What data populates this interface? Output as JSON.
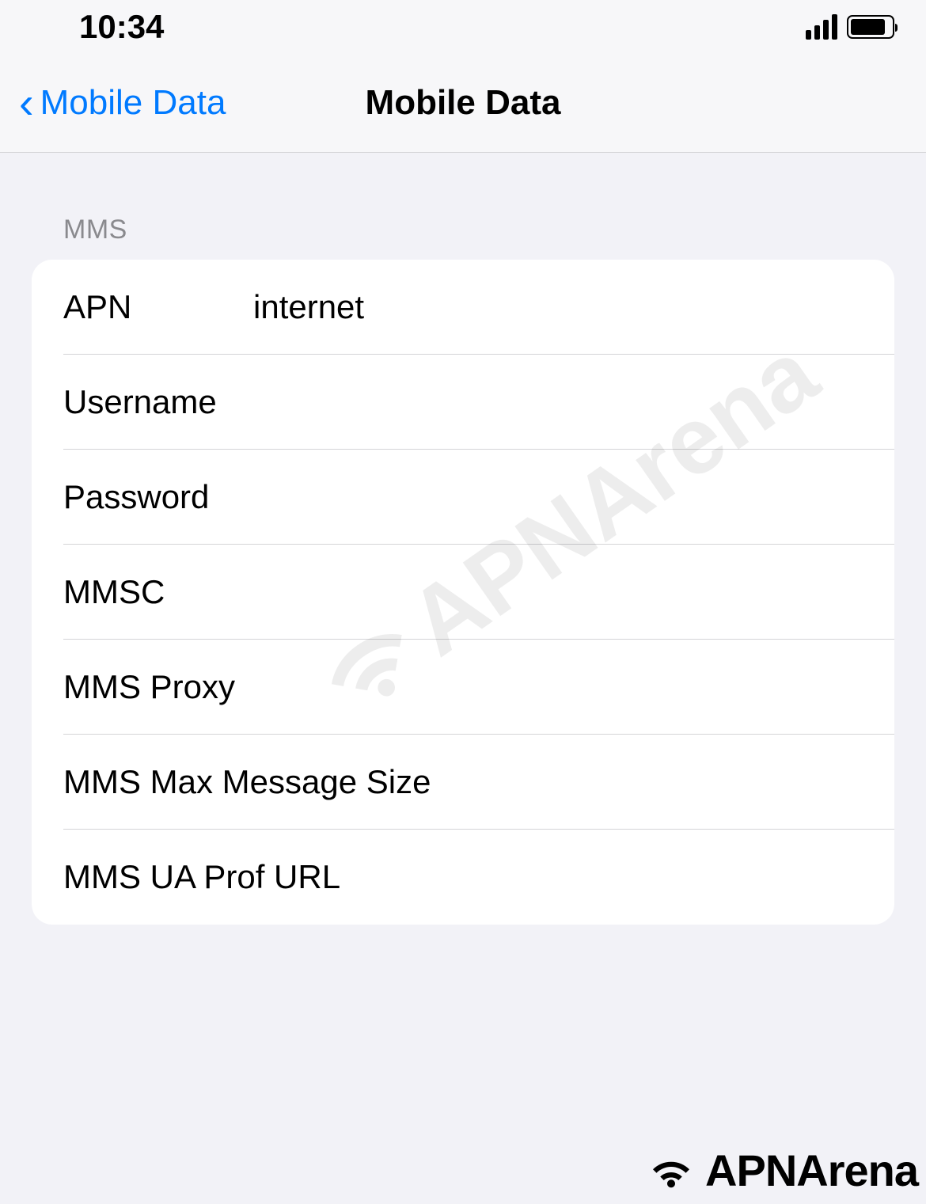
{
  "status": {
    "time": "10:34"
  },
  "nav": {
    "back_label": "Mobile Data",
    "title": "Mobile Data"
  },
  "section": {
    "header": "MMS"
  },
  "fields": {
    "apn": {
      "label": "APN",
      "value": "internet"
    },
    "username": {
      "label": "Username",
      "value": ""
    },
    "password": {
      "label": "Password",
      "value": ""
    },
    "mmsc": {
      "label": "MMSC",
      "value": ""
    },
    "mms_proxy": {
      "label": "MMS Proxy",
      "value": ""
    },
    "mms_max_size": {
      "label": "MMS Max Message Size",
      "value": ""
    },
    "mms_ua_prof": {
      "label": "MMS UA Prof URL",
      "value": ""
    }
  },
  "watermark": {
    "text": "APNArena"
  },
  "footer": {
    "brand": "APNArena"
  }
}
